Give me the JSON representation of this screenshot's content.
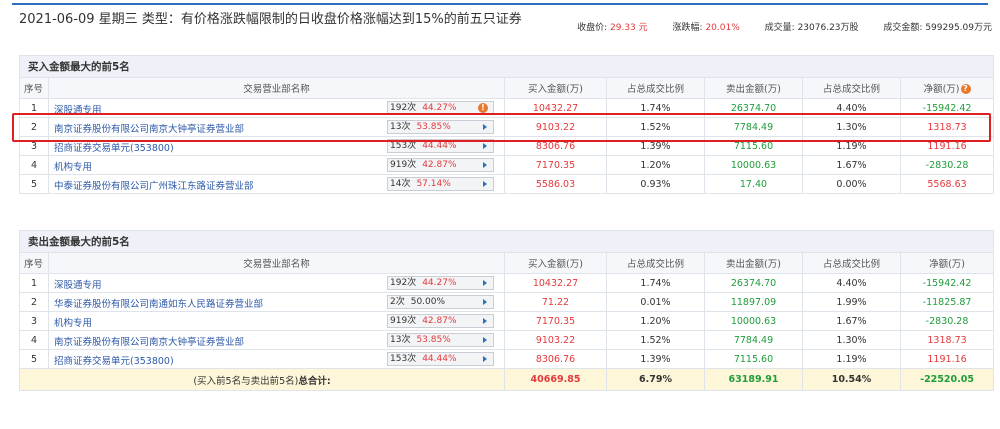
{
  "header": {
    "title": "2021-06-09 星期三 类型：有价格涨跌幅限制的日收盘价格涨幅达到15%的前五只证券",
    "close_label": "收盘价:",
    "close_value": "29.33 元",
    "change_label": "涨跌幅:",
    "change_value": "20.01%",
    "volume_label": "成交量:",
    "volume_value": "23076.23万股",
    "amount_label": "成交金额:",
    "amount_value": "599295.09万元"
  },
  "columns": {
    "seq": "序号",
    "dept": "交易营业部名称",
    "buy": "买入金额(万)",
    "buy_pct": "占总成交比例",
    "sell": "卖出金额(万)",
    "sell_pct": "占总成交比例",
    "net": "净额(万)"
  },
  "icons": {
    "help": "?",
    "warn": "!"
  },
  "buy_section": {
    "title": "买入金额最大的前5名",
    "rows": [
      {
        "seq": "1",
        "dept": "深股通专用",
        "count": "192次",
        "pct": "44.27%",
        "buy": "10432.27",
        "buy_pct": "1.74%",
        "sell": "26374.70",
        "sell_pct": "4.40%",
        "net": "-15942.42"
      },
      {
        "seq": "2",
        "dept": "南京证券股份有限公司南京大钟亭证券营业部",
        "count": "13次",
        "pct": "53.85%",
        "buy": "9103.22",
        "buy_pct": "1.52%",
        "sell": "7784.49",
        "sell_pct": "1.30%",
        "net": "1318.73"
      },
      {
        "seq": "3",
        "dept": "招商证券交易单元(353800)",
        "count": "153次",
        "pct": "44.44%",
        "buy": "8306.76",
        "buy_pct": "1.39%",
        "sell": "7115.60",
        "sell_pct": "1.19%",
        "net": "1191.16"
      },
      {
        "seq": "4",
        "dept": "机构专用",
        "count": "919次",
        "pct": "42.87%",
        "buy": "7170.35",
        "buy_pct": "1.20%",
        "sell": "10000.63",
        "sell_pct": "1.67%",
        "net": "-2830.28"
      },
      {
        "seq": "5",
        "dept": "中泰证券股份有限公司广州珠江东路证券营业部",
        "count": "14次",
        "pct": "57.14%",
        "buy": "5586.03",
        "buy_pct": "0.93%",
        "sell": "17.40",
        "sell_pct": "0.00%",
        "net": "5568.63"
      }
    ]
  },
  "sell_section": {
    "title": "卖出金额最大的前5名",
    "rows": [
      {
        "seq": "1",
        "dept": "深股通专用",
        "count": "192次",
        "pct": "44.27%",
        "buy": "10432.27",
        "buy_pct": "1.74%",
        "sell": "26374.70",
        "sell_pct": "4.40%",
        "net": "-15942.42"
      },
      {
        "seq": "2",
        "dept": "华泰证券股份有限公司南通如东人民路证券营业部",
        "count": "2次",
        "pct": "50.00%",
        "buy": "71.22",
        "buy_pct": "0.01%",
        "sell": "11897.09",
        "sell_pct": "1.99%",
        "net": "-11825.87"
      },
      {
        "seq": "3",
        "dept": "机构专用",
        "count": "919次",
        "pct": "42.87%",
        "buy": "7170.35",
        "buy_pct": "1.20%",
        "sell": "10000.63",
        "sell_pct": "1.67%",
        "net": "-2830.28"
      },
      {
        "seq": "4",
        "dept": "南京证券股份有限公司南京大钟亭证券营业部",
        "count": "13次",
        "pct": "53.85%",
        "buy": "9103.22",
        "buy_pct": "1.52%",
        "sell": "7784.49",
        "sell_pct": "1.30%",
        "net": "1318.73"
      },
      {
        "seq": "5",
        "dept": "招商证券交易单元(353800)",
        "count": "153次",
        "pct": "44.44%",
        "buy": "8306.76",
        "buy_pct": "1.39%",
        "sell": "7115.60",
        "sell_pct": "1.19%",
        "net": "1191.16"
      }
    ]
  },
  "total": {
    "label_prefix": "(买入前5名与卖出前5名)",
    "label_bold": "总合计:",
    "buy": "40669.85",
    "buy_pct": "6.79%",
    "sell": "63189.91",
    "sell_pct": "10.54%",
    "net": "-22520.05"
  },
  "colors": {
    "red": "#e4393c",
    "green": "#1e9d3a",
    "link": "#2e5aa8",
    "accent": "#2c6fbf"
  }
}
